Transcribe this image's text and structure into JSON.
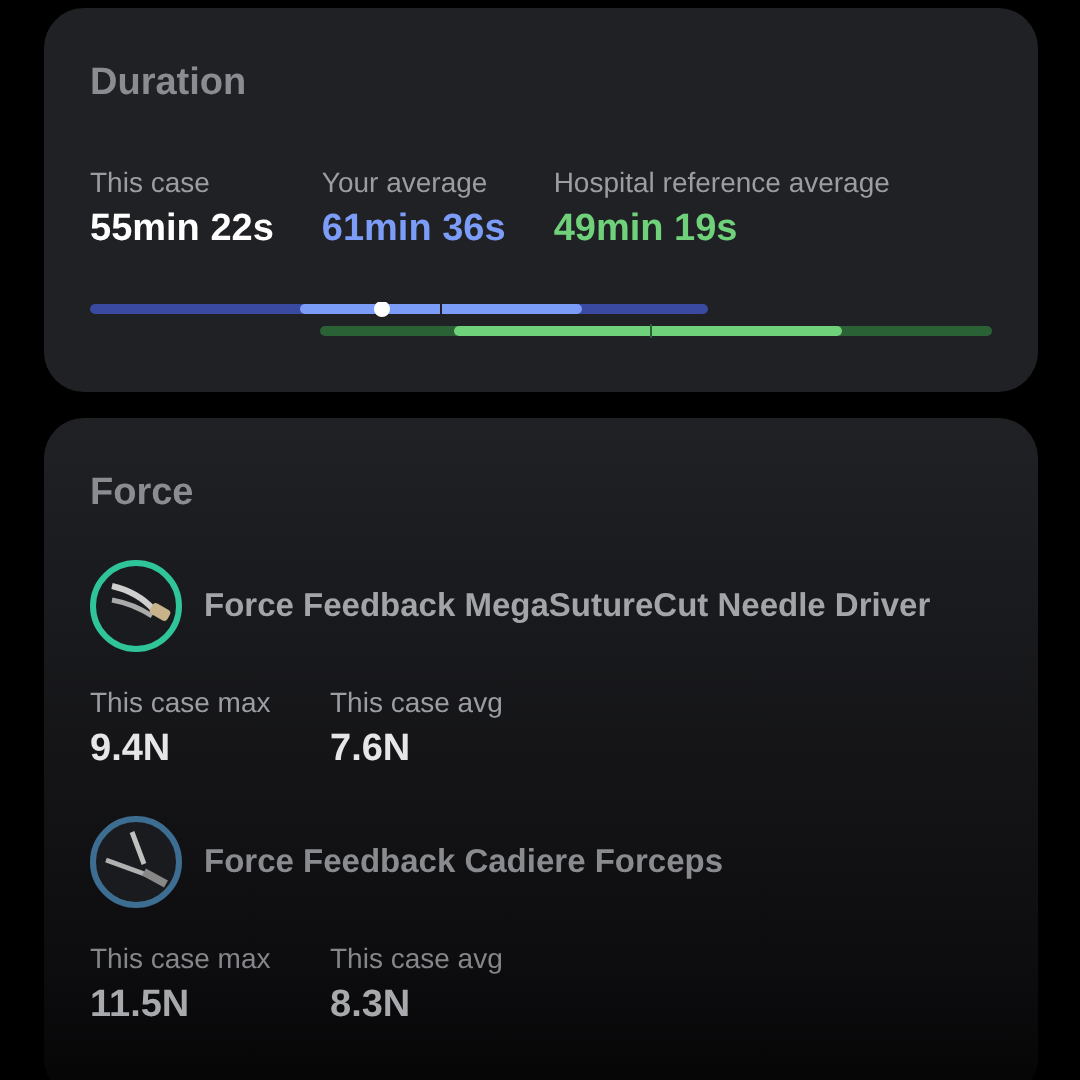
{
  "duration": {
    "title": "Duration",
    "stats": [
      {
        "label": "This case",
        "value": "55min 22s",
        "color": "#ffffff"
      },
      {
        "label": "Your average",
        "value": "61min 36s",
        "color": "#7b9cf7"
      },
      {
        "label": "Hospital reference average",
        "value": "49min 19s",
        "color": "#6fd17a"
      }
    ]
  },
  "force": {
    "title": "Force",
    "tools": [
      {
        "name": "Force Feedback MegaSutureCut Needle Driver",
        "color": "#2fc49a",
        "stats": [
          {
            "label": "This case max",
            "value": "9.4N"
          },
          {
            "label": "This case avg",
            "value": "7.6N"
          }
        ]
      },
      {
        "name": "Force Feedback Cadiere Forceps",
        "color": "#3d6e91",
        "stats": [
          {
            "label": "This case max",
            "value": "11.5N"
          },
          {
            "label": "This case avg",
            "value": "8.3N"
          }
        ]
      }
    ]
  }
}
